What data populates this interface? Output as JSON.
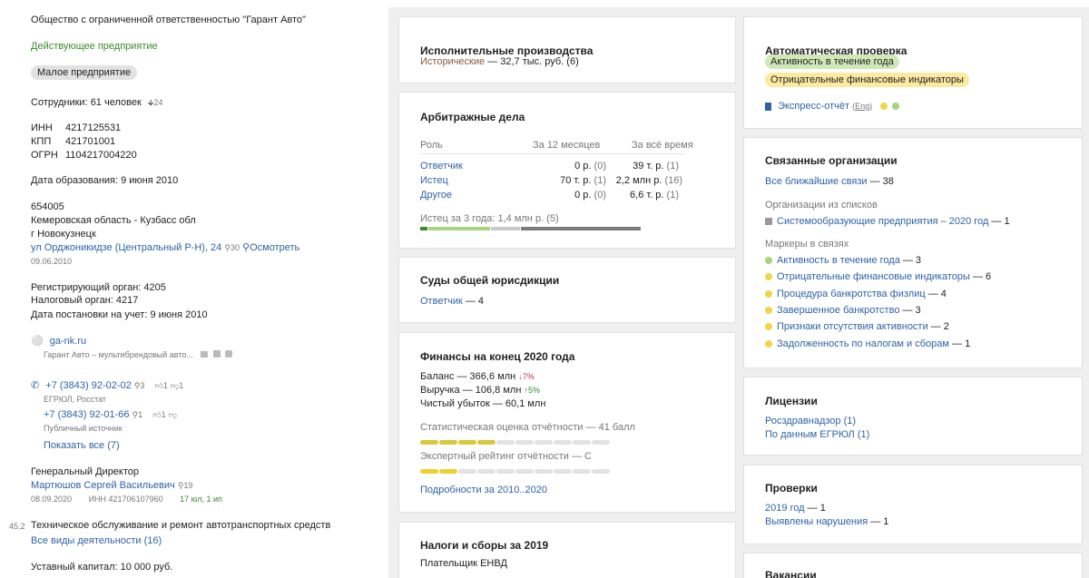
{
  "left": {
    "org_name": "Общество с ограниченной ответственностью \"Гарант Авто\"",
    "status": "Действующее предприятие",
    "size_badge": "Малое предприятие",
    "employees": "Сотрудники: 61 человек",
    "employees_delta": "24",
    "inn_label": "ИНН",
    "inn": "4217125531",
    "kpp_label": "КПП",
    "kpp": "421701001",
    "ogrn_label": "ОГРН",
    "ogrn": "1104217004220",
    "formation": "Дата образования: 9 июня 2010",
    "address_zip": "654005",
    "address_region": "Кемеровская область - Кузбасс обл",
    "address_city": "г Новокузнецк",
    "address_street": "ул Орджоникидзе (Центральный Р-Н), 24",
    "address_count": "30",
    "address_show": "Осмотреть",
    "address_date": "09.06.2010",
    "reg_body": "Регистрирующий орган: 4205",
    "tax_body": "Налоговый орган: 4217",
    "reg_date": "Дата постановки на учет: 9 июня 2010",
    "site": "ga-nk.ru",
    "site_desc": "Гарант Авто – мультибрендовый авто...",
    "phone1": "+7 (3843) 92-02-02",
    "phone1_count": "3",
    "phone1_likes": "1",
    "phone1_dislikes": "1",
    "phone1_src": "ЕГРЮЛ, Росстат",
    "phone2": "+7 (3843) 92-01-66",
    "phone2_count": "1",
    "phone2_likes": "1",
    "phone2_src": "Публичный источник",
    "show_all": "Показать все (7)",
    "director_title": "Генеральный Директор",
    "director_name": "Мартюшов Сергей Васильевич",
    "director_count": "19",
    "director_date": "08.09.2020",
    "director_inn": "ИНН 421706107960",
    "director_tenure": "17 юл, 1 ип",
    "okved_code": "45.2",
    "okved_name": "Техническое обслуживание и ремонт автотранспортных средств",
    "all_activities": "Все виды деятельности (16)",
    "capital": "Уставный капитал: 10 000 руб."
  },
  "exec": {
    "title": "Исполнительные производства",
    "hist_label": "Исторические",
    "hist_value": " — 32,7 тыс. руб. (6)"
  },
  "arb": {
    "title": "Арбитражные дела",
    "col_role": "Роль",
    "col_12m": "За 12 месяцев",
    "col_all": "За всё время",
    "rows": [
      {
        "role": "Ответчик",
        "m12": "0 р.",
        "m12c": "(0)",
        "all": "39 т. р.",
        "allc": "(1)"
      },
      {
        "role": "Истец",
        "m12": "70 т. р.",
        "m12c": "(1)",
        "all": "2,2 млн р.",
        "allc": "(16)"
      },
      {
        "role": "Другое",
        "m12": "0 р.",
        "m12c": "(0)",
        "all": "6,6 т. р.",
        "allc": "(1)"
      }
    ],
    "footer": "Истец за 3 года: 1,4 млн р. (5)"
  },
  "courts": {
    "title": "Суды общей юрисдикции",
    "line_label": "Ответчик",
    "line_value": " — 4"
  },
  "finance": {
    "title": "Финансы на конец 2020 года",
    "balance": "Баланс — 366,6 млн",
    "balance_delta": "7%",
    "revenue": "Выручка — 106,8 млн",
    "revenue_delta": "5%",
    "loss": "Чистый убыток — 60,1 млн",
    "stat_label": "Статистическая оценка отчётности — 41 балл",
    "stat_score": 41,
    "expert_label": "Экспертный рейтинг отчётности — C",
    "details": "Подробности за 2010..2020"
  },
  "taxes": {
    "title": "Налоги и сборы за 2019",
    "line": "Плательщик ЕНВД"
  },
  "auto": {
    "title": "Автоматическая проверка",
    "tag1": "Активность в течение года",
    "tag2": "Отрицательные финансовые индикаторы",
    "express": "Экспресс-отчёт",
    "eng": "Eng"
  },
  "related": {
    "title": "Связанные организации",
    "nearest_label": "Все ближайшие связи",
    "nearest_value": " — 38",
    "lists_title": "Организации из списков",
    "list_item_label": "Системообразующие предприятия – 2020 год",
    "list_item_value": " — 1",
    "markers_title": "Маркеры в связях",
    "markers": [
      {
        "label": "Активность в течение года",
        "value": " — 3",
        "color": "#a8d47a"
      },
      {
        "label": "Отрицательные финансовые индикаторы",
        "value": " — 6",
        "color": "#f0d44a"
      },
      {
        "label": "Процедура банкротства физлиц",
        "value": " — 4",
        "color": "#f0d44a"
      },
      {
        "label": "Завершенное банкротство",
        "value": " — 3",
        "color": "#f0d44a"
      },
      {
        "label": "Признаки отсутствия активности",
        "value": " — 2",
        "color": "#f0d44a"
      },
      {
        "label": "Задолженность по налогам и сборам",
        "value": " — 1",
        "color": "#f0d44a"
      }
    ]
  },
  "licenses": {
    "title": "Лицензии",
    "l1": "Росздравнадзор (1)",
    "l2": "По данным ЕГРЮЛ (1)"
  },
  "checks": {
    "title": "Проверки",
    "c1_label": "2019 год",
    "c1_value": " — 1",
    "c2_label": "Выявлены нарушения",
    "c2_value": " — 1"
  },
  "vacancies": {
    "title": "Вакансии"
  }
}
